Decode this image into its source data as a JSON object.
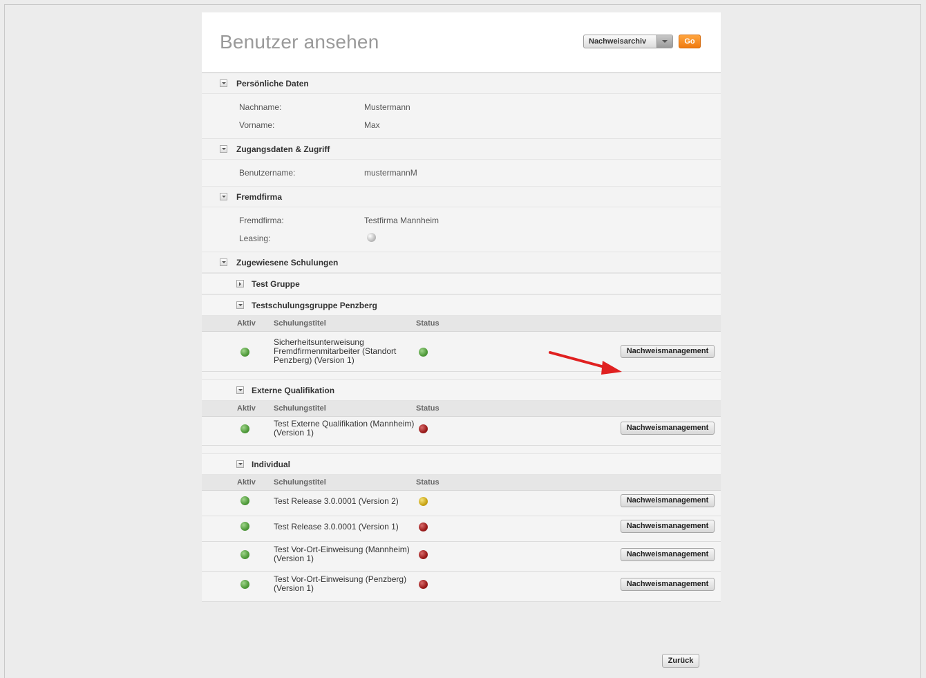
{
  "page": {
    "title": "Benutzer ansehen"
  },
  "header": {
    "archive_select_value": "Nachweisarchiv",
    "go_label": "Go"
  },
  "sections": {
    "personal": {
      "title": "Persönliche Daten",
      "fields": [
        {
          "label": "Nachname:",
          "value": "Mustermann"
        },
        {
          "label": "Vorname:",
          "value": "Max"
        }
      ]
    },
    "access": {
      "title": "Zugangsdaten & Zugriff",
      "fields": [
        {
          "label": "Benutzername:",
          "value": "mustermannM"
        }
      ]
    },
    "company": {
      "title": "Fremdfirma",
      "fields": [
        {
          "label": "Fremdfirma:",
          "value": "Testfirma Mannheim"
        },
        {
          "label": "Leasing:",
          "value": ""
        }
      ]
    },
    "trainings": {
      "title": "Zugewiesene Schulungen",
      "columns": {
        "active": "Aktiv",
        "title": "Schulungstitel",
        "status": "Status"
      },
      "button_label": "Nachweismanagement",
      "groups": [
        {
          "title": "Test Gruppe",
          "expanded": false,
          "rows": []
        },
        {
          "title": "Testschulungsgruppe Penzberg",
          "expanded": true,
          "rows": [
            {
              "active": "green",
              "title": "Sicherheitsunterweisung Fremdfirmenmitarbeiter (Standort Penzberg) (Version 1)",
              "status": "green"
            }
          ]
        },
        {
          "title": "Externe Qualifikation",
          "expanded": true,
          "rows": [
            {
              "active": "green",
              "title": "Test Externe Qualifikation (Mannheim) (Version 1)",
              "status": "red"
            }
          ]
        },
        {
          "title": "Individual",
          "expanded": true,
          "rows": [
            {
              "active": "green",
              "title": "Test Release 3.0.0001 (Version 2)",
              "status": "yellow"
            },
            {
              "active": "green",
              "title": "Test Release 3.0.0001 (Version 1)",
              "status": "red"
            },
            {
              "active": "green",
              "title": "Test Vor-Ort-Einweisung (Mannheim) (Version 1)",
              "status": "red"
            },
            {
              "active": "green",
              "title": "Test Vor-Ort-Einweisung (Penzberg) (Version 1)",
              "status": "red"
            }
          ]
        }
      ]
    }
  },
  "footer": {
    "back_label": "Zurück"
  },
  "colors": {
    "accent": "#f08a1c",
    "status_green": "#4f9a3a",
    "status_red": "#9a1b1b",
    "status_yellow": "#c9a516",
    "annotation_arrow": "#e02020"
  }
}
